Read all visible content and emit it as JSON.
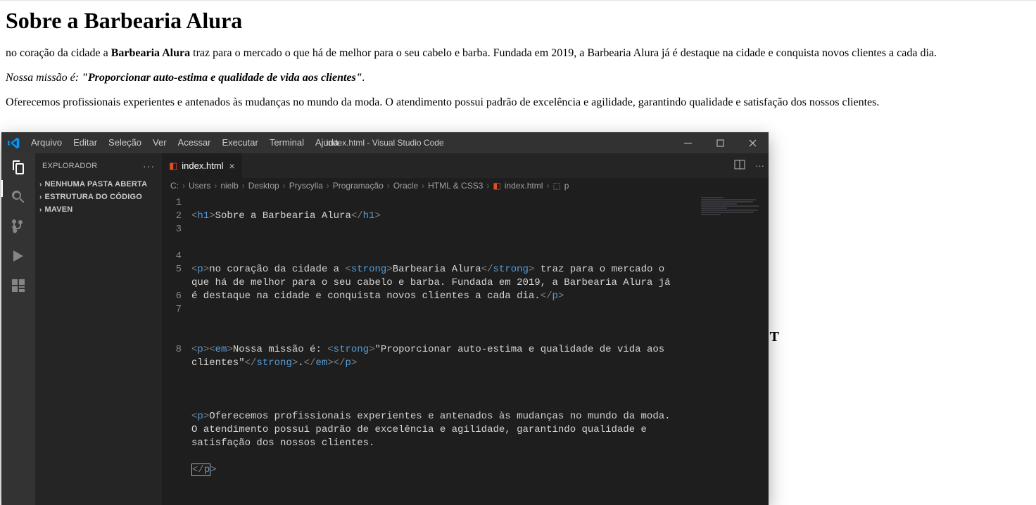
{
  "page": {
    "h1": "Sobre a Barbearia Alura",
    "p1_a": "no coração da cidade a ",
    "p1_strong": "Barbearia Alura",
    "p1_b": " traz para o mercado o que há de melhor para o seu cabelo e barba. Fundada em 2019, a Barbearia Alura já é destaque na cidade e conquista novos clientes a cada dia.",
    "p2_em_a": "Nossa missão é: ",
    "p2_em_strong": "\"Proporcionar auto-estima e qualidade de vida aos clientes\"",
    "p2_em_b": ".",
    "p3": "Oferecemos profissionais experientes e antenados às mudanças no mundo da moda. O atendimento possui padrão de excelência e agilidade, garantindo qualidade e satisfação dos nossos clientes."
  },
  "vscode": {
    "menus": [
      "Arquivo",
      "Editar",
      "Seleção",
      "Ver",
      "Acessar",
      "Executar",
      "Terminal",
      "Ajuda"
    ],
    "window_title": "index.html - Visual Studio Code",
    "explorer_title": "EXPLORADOR",
    "sidebar_sections": [
      "NENHUMA PASTA ABERTA",
      "ESTRUTURA DO CÓDIGO",
      "MAVEN"
    ],
    "tab_name": "index.html",
    "breadcrumb": [
      "C:",
      "Users",
      "nielb",
      "Desktop",
      "Pryscylla",
      "Programação",
      "Oracle",
      "HTML & CSS3",
      "index.html",
      "p"
    ],
    "line_numbers": [
      "1",
      "2",
      "3",
      "",
      "4",
      "5",
      "",
      "6",
      "7",
      "",
      "",
      "8"
    ],
    "code": {
      "l1": {
        "open": "<",
        "tag": "h1",
        "gt": ">",
        "txt": "Sobre a Barbearia Alura",
        "open2": "</",
        "tag2": "h1",
        "gt2": ">"
      },
      "l3": {
        "open": "<",
        "tag": "p",
        "gt": ">",
        "txt1": "no coração da cidade a ",
        "sopen": "<",
        "stag": "strong",
        "sgt": ">",
        "stxt": "Barbearia Alura",
        "sclose": "</",
        "stag2": "strong",
        "sgt2": ">",
        "txt2": " traz para o mercado o que há de melhor para o seu cabelo e barba. Fundada em 2019, a Barbearia Alura já é destaque na cidade e conquista novos clientes a cada dia.",
        "close": "</",
        "ctag": "p",
        "cgt": ">"
      },
      "l5": {
        "open": "<",
        "tag": "p",
        "gt": ">",
        "eopen": "<",
        "etag": "em",
        "egt": ">",
        "txt1": "Nossa missão é: ",
        "sopen": "<",
        "stag": "strong",
        "sgt": ">",
        "stxt": "\"Proporcionar auto-estima e qualidade de vida aos clientes\"",
        "sclose": "</",
        "stag2": "strong",
        "sgt2": ">",
        "txt2": ".",
        "eclose": "</",
        "etag2": "em",
        "egt2": ">",
        "close": "</",
        "ctag": "p",
        "cgt": ">"
      },
      "l7": {
        "open": "<",
        "tag": "p",
        "gt": ">",
        "txt": "Oferecemos profissionais experientes e antenados às mudanças no mundo da moda. O atendimento possui padrão de excelência e agilidade, garantindo qualidade e satisfação dos nossos clientes."
      },
      "l8": {
        "open": "<",
        "slash": "/",
        "tag": "p",
        "gt": ">"
      }
    }
  },
  "side_letter": "T"
}
